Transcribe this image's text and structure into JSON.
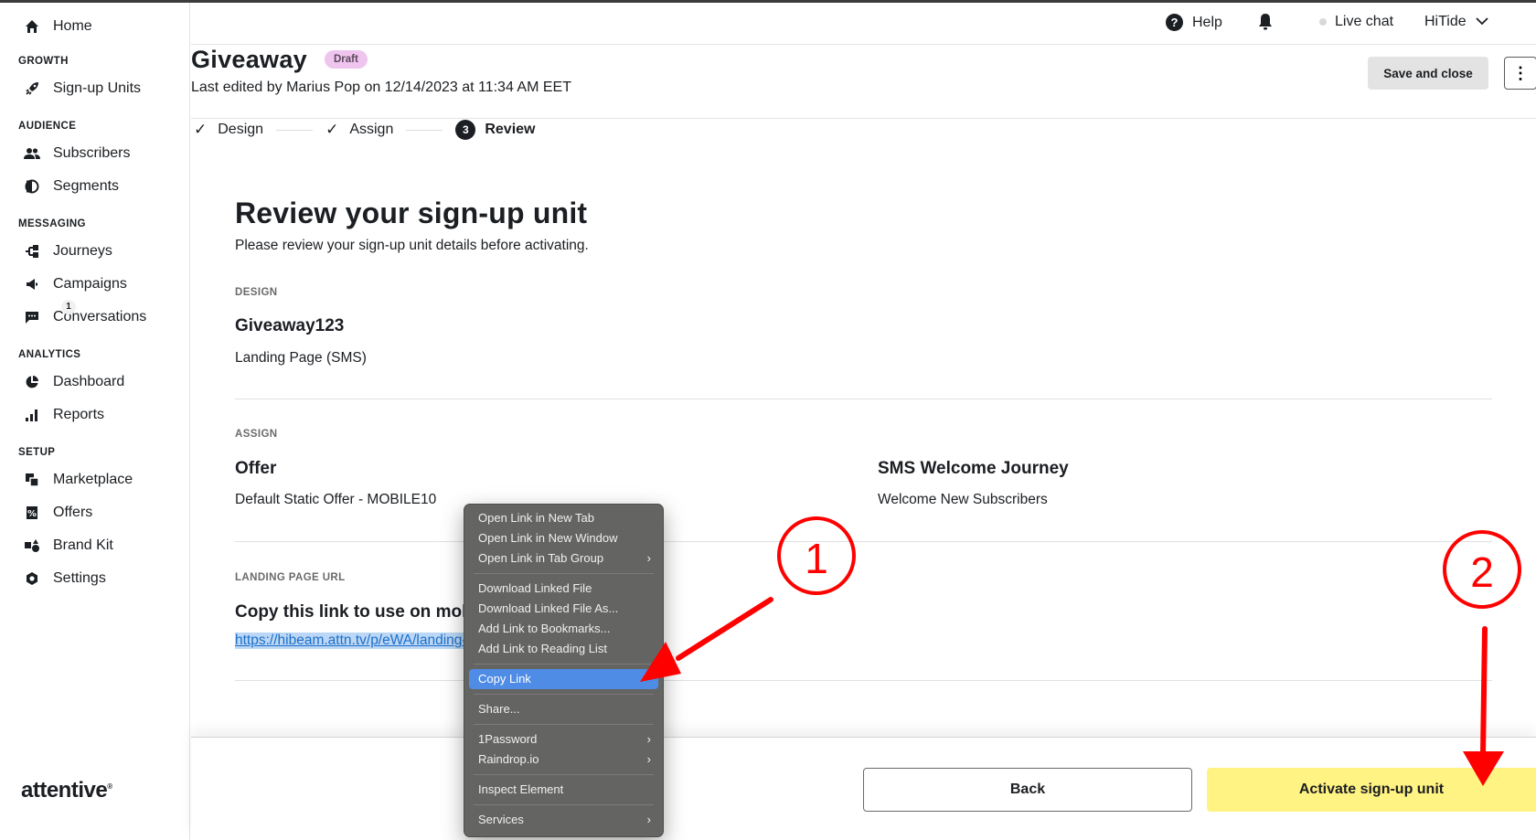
{
  "sidebar": {
    "home": "Home",
    "sections": {
      "growth": "GROWTH",
      "audience": "AUDIENCE",
      "messaging": "MESSAGING",
      "analytics": "ANALYTICS",
      "setup": "SETUP"
    },
    "items": {
      "signup_units": "Sign-up Units",
      "subscribers": "Subscribers",
      "segments": "Segments",
      "journeys": "Journeys",
      "campaigns": "Campaigns",
      "conversations": "Conversations",
      "conversations_badge": "1",
      "dashboard": "Dashboard",
      "reports": "Reports",
      "marketplace": "Marketplace",
      "offers": "Offers",
      "brand_kit": "Brand Kit",
      "settings": "Settings"
    },
    "logo": "attentive",
    "logo_mark": "®"
  },
  "header": {
    "help": "Help",
    "help_icon": "?",
    "live_chat": "Live chat",
    "account": "HiTide"
  },
  "page": {
    "title": "Giveaway",
    "status_badge": "Draft",
    "last_edited": "Last edited by Marius Pop on 12/14/2023 at 11:34 AM EET",
    "save_close": "Save and close",
    "more_icon": "⋮"
  },
  "stepper": {
    "steps": [
      {
        "label": "Design",
        "state": "complete",
        "icon": "✓"
      },
      {
        "label": "Assign",
        "state": "complete",
        "icon": "✓"
      },
      {
        "label": "Review",
        "state": "active",
        "number": "3"
      }
    ]
  },
  "review": {
    "heading": "Review your sign-up unit",
    "subtitle": "Please review your sign-up unit details before activating.",
    "design": {
      "label": "DESIGN",
      "name": "Giveaway123",
      "type": "Landing Page (SMS)"
    },
    "assign": {
      "label": "ASSIGN",
      "offer_title": "Offer",
      "offer_value": "Default Static Offer - MOBILE10",
      "journey_title": "SMS Welcome Journey",
      "journey_value": "Welcome New Subscribers"
    },
    "landing_page": {
      "label": "LANDING PAGE URL",
      "title": "Copy this link to use on mobile",
      "url": "https://hibeam.attn.tv/p/eWA/landing-page"
    }
  },
  "footer": {
    "back": "Back",
    "activate": "Activate sign-up unit"
  },
  "context_menu": {
    "groups": [
      [
        {
          "label": "Open Link in New Tab"
        },
        {
          "label": "Open Link in New Window"
        },
        {
          "label": "Open Link in Tab Group",
          "submenu": true
        }
      ],
      [
        {
          "label": "Download Linked File"
        },
        {
          "label": "Download Linked File As..."
        },
        {
          "label": "Add Link to Bookmarks..."
        },
        {
          "label": "Add Link to Reading List"
        }
      ],
      [
        {
          "label": "Copy Link",
          "selected": true
        }
      ],
      [
        {
          "label": "Share..."
        }
      ],
      [
        {
          "label": "1Password",
          "submenu": true
        },
        {
          "label": "Raindrop.io",
          "submenu": true
        }
      ],
      [
        {
          "label": "Inspect Element"
        }
      ],
      [
        {
          "label": "Services",
          "submenu": true
        }
      ]
    ],
    "submenu_arrow": "›"
  },
  "annotations": {
    "step1": "1",
    "step2": "2",
    "color": "#ff0000"
  },
  "colors": {
    "accent_yellow": "#fff383",
    "draft_badge": "#efc4ef",
    "link": "#1c6fc9",
    "menu_selected": "#4f8ce6"
  }
}
